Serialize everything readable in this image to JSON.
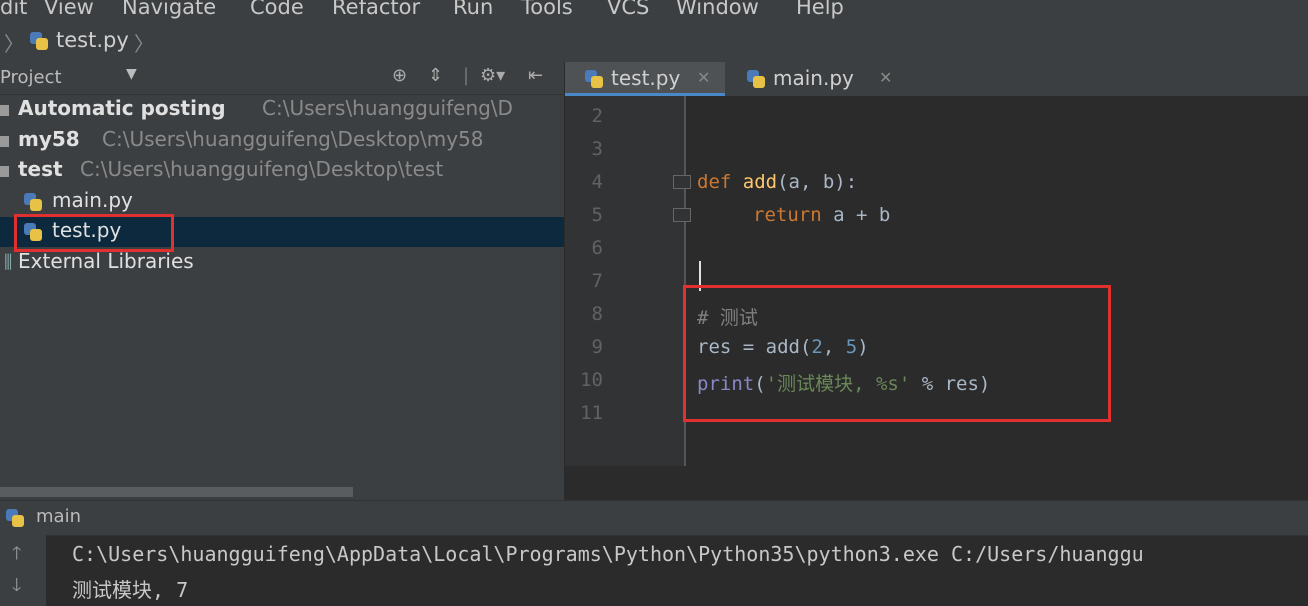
{
  "menubar": {
    "items": [
      "dit",
      "View",
      "Navigate",
      "Code",
      "Refactor",
      "Run",
      "Tools",
      "VCS",
      "Window",
      "Help"
    ]
  },
  "breadcrumb": {
    "file": "test.py"
  },
  "project_panel": {
    "title": "Project",
    "tree": [
      {
        "name": "Automatic posting",
        "path": "C:\\Users\\huangguifeng\\D"
      },
      {
        "name": "my58",
        "path": "C:\\Users\\huangguifeng\\Desktop\\my58"
      },
      {
        "name": "test",
        "path": "C:\\Users\\huangguifeng\\Desktop\\test"
      },
      {
        "name": "main.py"
      },
      {
        "name": "test.py"
      },
      {
        "name": "External Libraries"
      }
    ]
  },
  "editor": {
    "tabs": [
      {
        "label": "test.py",
        "active": true
      },
      {
        "label": "main.py",
        "active": false
      }
    ],
    "line_numbers": [
      "2",
      "3",
      "4",
      "5",
      "6",
      "7",
      "8",
      "9",
      "10",
      "11"
    ],
    "code": {
      "l4_def": "def",
      "l4_fn": "add",
      "l4_rest": "(a, b):",
      "l5_kw": "return",
      "l5_rest": " a + b",
      "l8": "# 测试",
      "l9_a": "res = add(",
      "l9_n1": "2",
      "l9_b": ", ",
      "l9_n2": "5",
      "l9_c": ")",
      "l10_print": "print",
      "l10_a": "(",
      "l10_str": "'测试模块, %s'",
      "l10_b": " % res)"
    }
  },
  "run_panel": {
    "title": "main",
    "output": [
      "C:\\Users\\huangguifeng\\AppData\\Local\\Programs\\Python\\Python35\\python3.exe C:/Users/huanggu",
      "测试模块, 7"
    ]
  },
  "colors": {
    "highlight_box": "#e03030",
    "selection": "#0d293e",
    "active_tab_underline": "#4a88c7"
  }
}
